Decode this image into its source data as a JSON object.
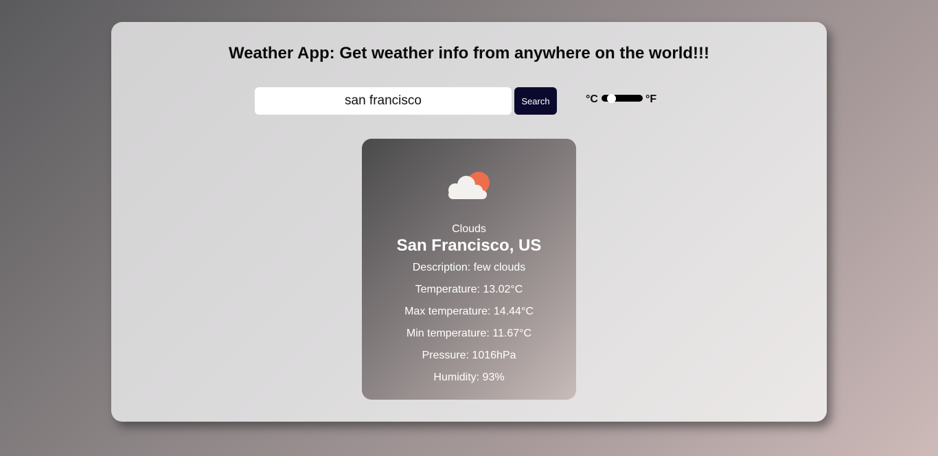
{
  "header": {
    "title": "Weather App: Get weather info from anywhere on the world!!!"
  },
  "search": {
    "value": "san francisco",
    "button_label": "Search"
  },
  "units": {
    "celsius_label": "°C",
    "fahrenheit_label": "°F",
    "selected": "celsius"
  },
  "weather": {
    "icon": "partly-cloudy-icon",
    "condition": "Clouds",
    "city": "San Francisco, US",
    "description": "Description: few clouds",
    "temperature": "Temperature: 13.02°C",
    "max_temperature": "Max temperature: 14.44°C",
    "min_temperature": "Min temperature: 11.67°C",
    "pressure": "Pressure: 1016hPa",
    "humidity": "Humidity: 93%"
  },
  "colors": {
    "button_bg": "#0b0a2e",
    "sun": "#ec6e4c",
    "cloud": "#f3f1ee"
  }
}
